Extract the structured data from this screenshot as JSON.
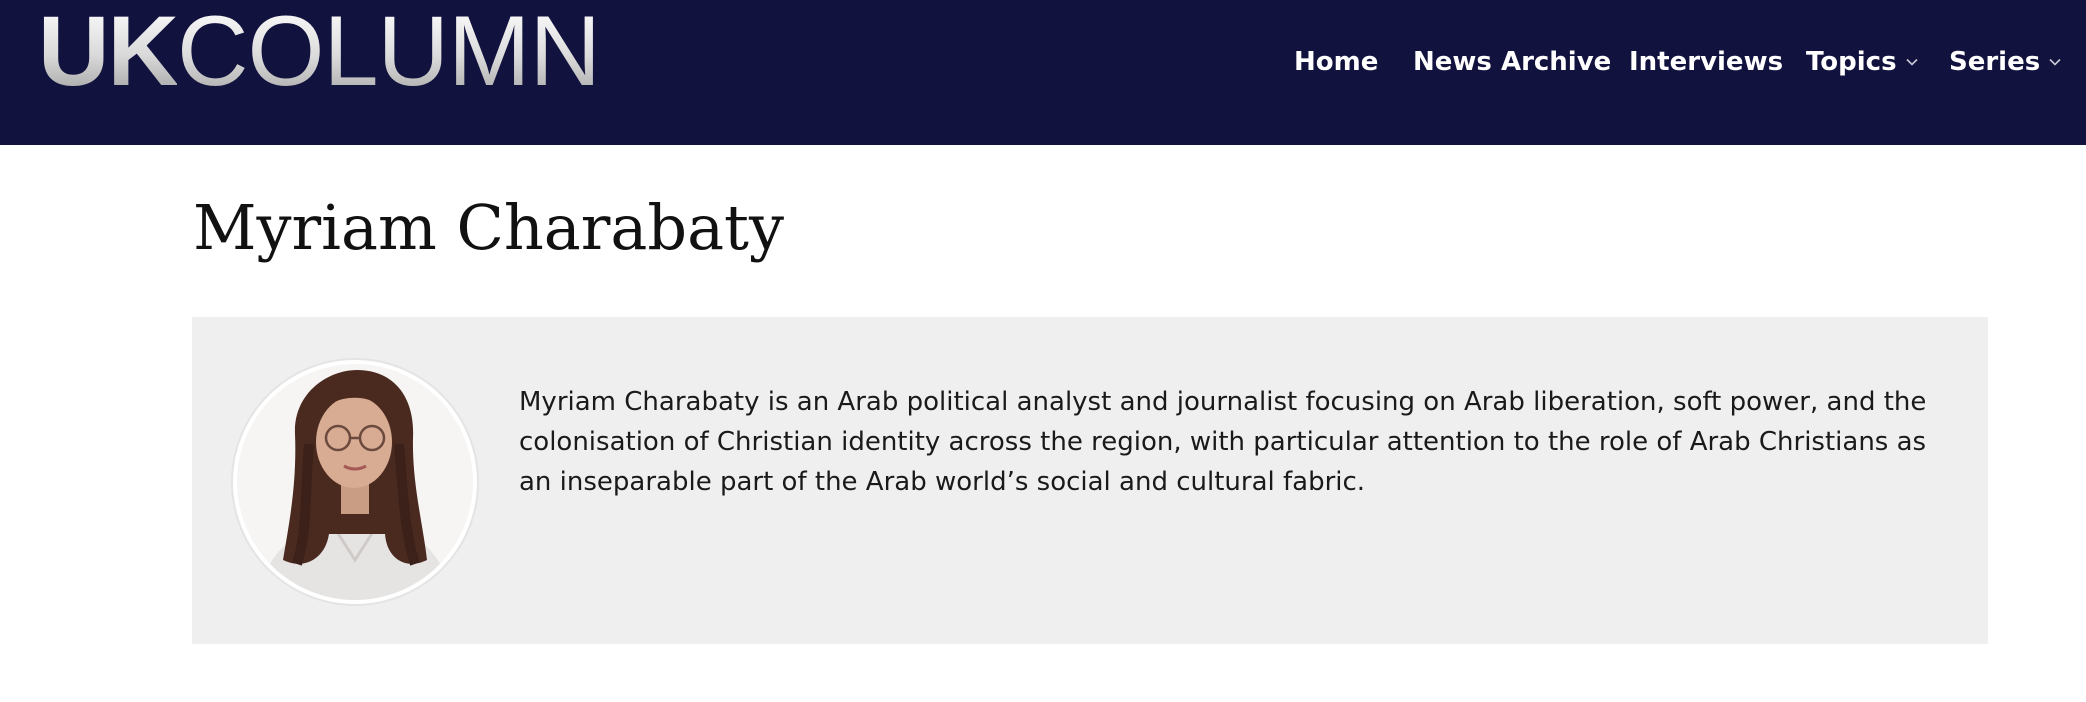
{
  "header": {
    "logo_bold": "UK",
    "logo_light": "COLUMN",
    "background_color": "#12123f"
  },
  "nav": {
    "items": [
      {
        "label": "Home",
        "has_dropdown": false
      },
      {
        "label": "News Archive",
        "has_dropdown": false
      },
      {
        "label": "Interviews",
        "has_dropdown": false
      },
      {
        "label": "Topics",
        "has_dropdown": true,
        "icon": "chevron-down-icon"
      },
      {
        "label": "Series",
        "has_dropdown": true,
        "icon": "chevron-down-icon"
      }
    ]
  },
  "author": {
    "name": "Myriam Charabaty",
    "bio": "Myriam Charabaty is an Arab political analyst and journalist focusing on Arab liberation, soft power, and the colonisation of Christian identity across the region, with particular attention to the role of Arab Christians as an inseparable part of the Arab world’s social and cultural fabric.",
    "card_background": "#efefef"
  }
}
